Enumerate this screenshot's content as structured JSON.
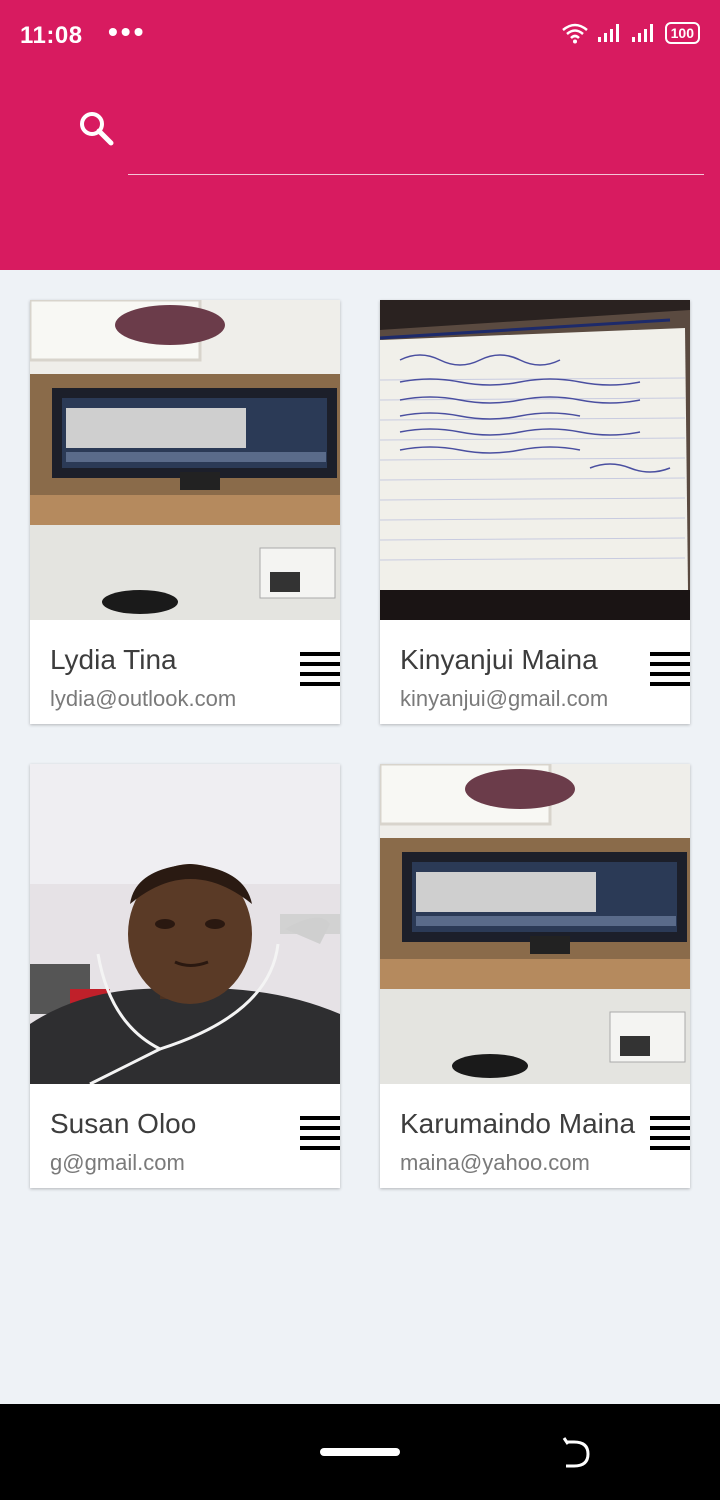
{
  "status_bar": {
    "time": "11:08",
    "dots": "•••",
    "battery": "100",
    "icons": [
      "wifi-icon",
      "signal-icon",
      "signal-icon",
      "battery-icon"
    ]
  },
  "header": {
    "background_color": "#d81b60",
    "search_icon": "search-icon",
    "search_value": ""
  },
  "contacts": [
    {
      "name": "Lydia Tina",
      "email": "lydia@outlook.com",
      "photo": "desk-computer-photo",
      "menu_icon": "menu-icon"
    },
    {
      "name": "Kinyanjui Maina",
      "email": "kinyanjui@gmail.com",
      "photo": "notebook-handwriting-photo",
      "menu_icon": "menu-icon"
    },
    {
      "name": "Susan Oloo",
      "email": "g@gmail.com",
      "photo": "selfie-photo",
      "menu_icon": "menu-icon"
    },
    {
      "name": "Karumaindo Maina",
      "email": "maina@yahoo.com",
      "photo": "desk-computer-photo",
      "menu_icon": "menu-icon"
    }
  ],
  "nav_bar": {
    "home_icon": "home-pill-icon",
    "back_icon": "back-icon"
  }
}
